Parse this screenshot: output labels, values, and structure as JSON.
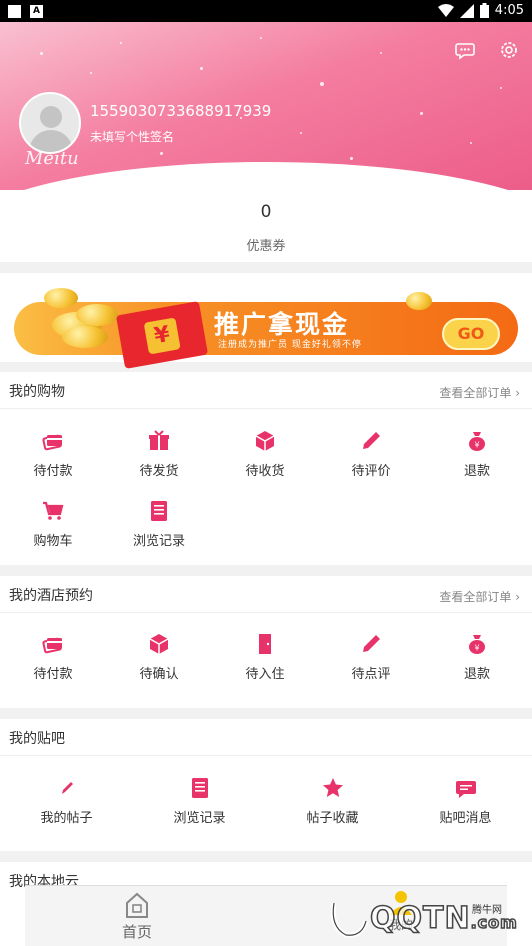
{
  "statusbar": {
    "time": "4:05",
    "notif_icon": "A"
  },
  "header": {
    "user_id": "1559030733688917939",
    "signature": "未填写个性签名",
    "watermark_logo": "Meitu"
  },
  "coupon": {
    "count": "0",
    "label": "优惠券"
  },
  "banner": {
    "main_text": "推广拿现金",
    "sub_text": "注册成为推广员  现金好礼领不停",
    "go_label": "GO",
    "envelope_symbol": "¥"
  },
  "shopping": {
    "title": "我的购物",
    "more": "查看全部订单",
    "items": [
      {
        "label": "待付款",
        "icon": "wallet-icon"
      },
      {
        "label": "待发货",
        "icon": "gift-box-icon"
      },
      {
        "label": "待收货",
        "icon": "package-icon"
      },
      {
        "label": "待评价",
        "icon": "pencil-icon"
      },
      {
        "label": "退款",
        "icon": "money-bag-icon"
      },
      {
        "label": "购物车",
        "icon": "cart-icon"
      },
      {
        "label": "浏览记录",
        "icon": "document-icon"
      }
    ]
  },
  "hotel": {
    "title": "我的酒店预约",
    "more": "查看全部订单",
    "items": [
      {
        "label": "待付款",
        "icon": "wallet-icon"
      },
      {
        "label": "待确认",
        "icon": "package-icon"
      },
      {
        "label": "待入住",
        "icon": "door-icon"
      },
      {
        "label": "待点评",
        "icon": "pencil-icon"
      },
      {
        "label": "退款",
        "icon": "money-bag-icon"
      }
    ]
  },
  "forum": {
    "title": "我的贴吧",
    "items": [
      {
        "label": "我的帖子",
        "icon": "pen-icon"
      },
      {
        "label": "浏览记录",
        "icon": "document-icon"
      },
      {
        "label": "帖子收藏",
        "icon": "star-icon"
      },
      {
        "label": "贴吧消息",
        "icon": "message-icon"
      }
    ]
  },
  "cloud": {
    "title": "我的本地云"
  },
  "bottomnav": {
    "home_label": "首页",
    "mine_label": "我的"
  },
  "watermark": {
    "text": "QQTN",
    "tag": "腾牛网",
    "domain": ".com"
  },
  "colors": {
    "accent": "#e8336a",
    "pink_header": "#f47da0",
    "banner_orange": "#f46a14"
  }
}
